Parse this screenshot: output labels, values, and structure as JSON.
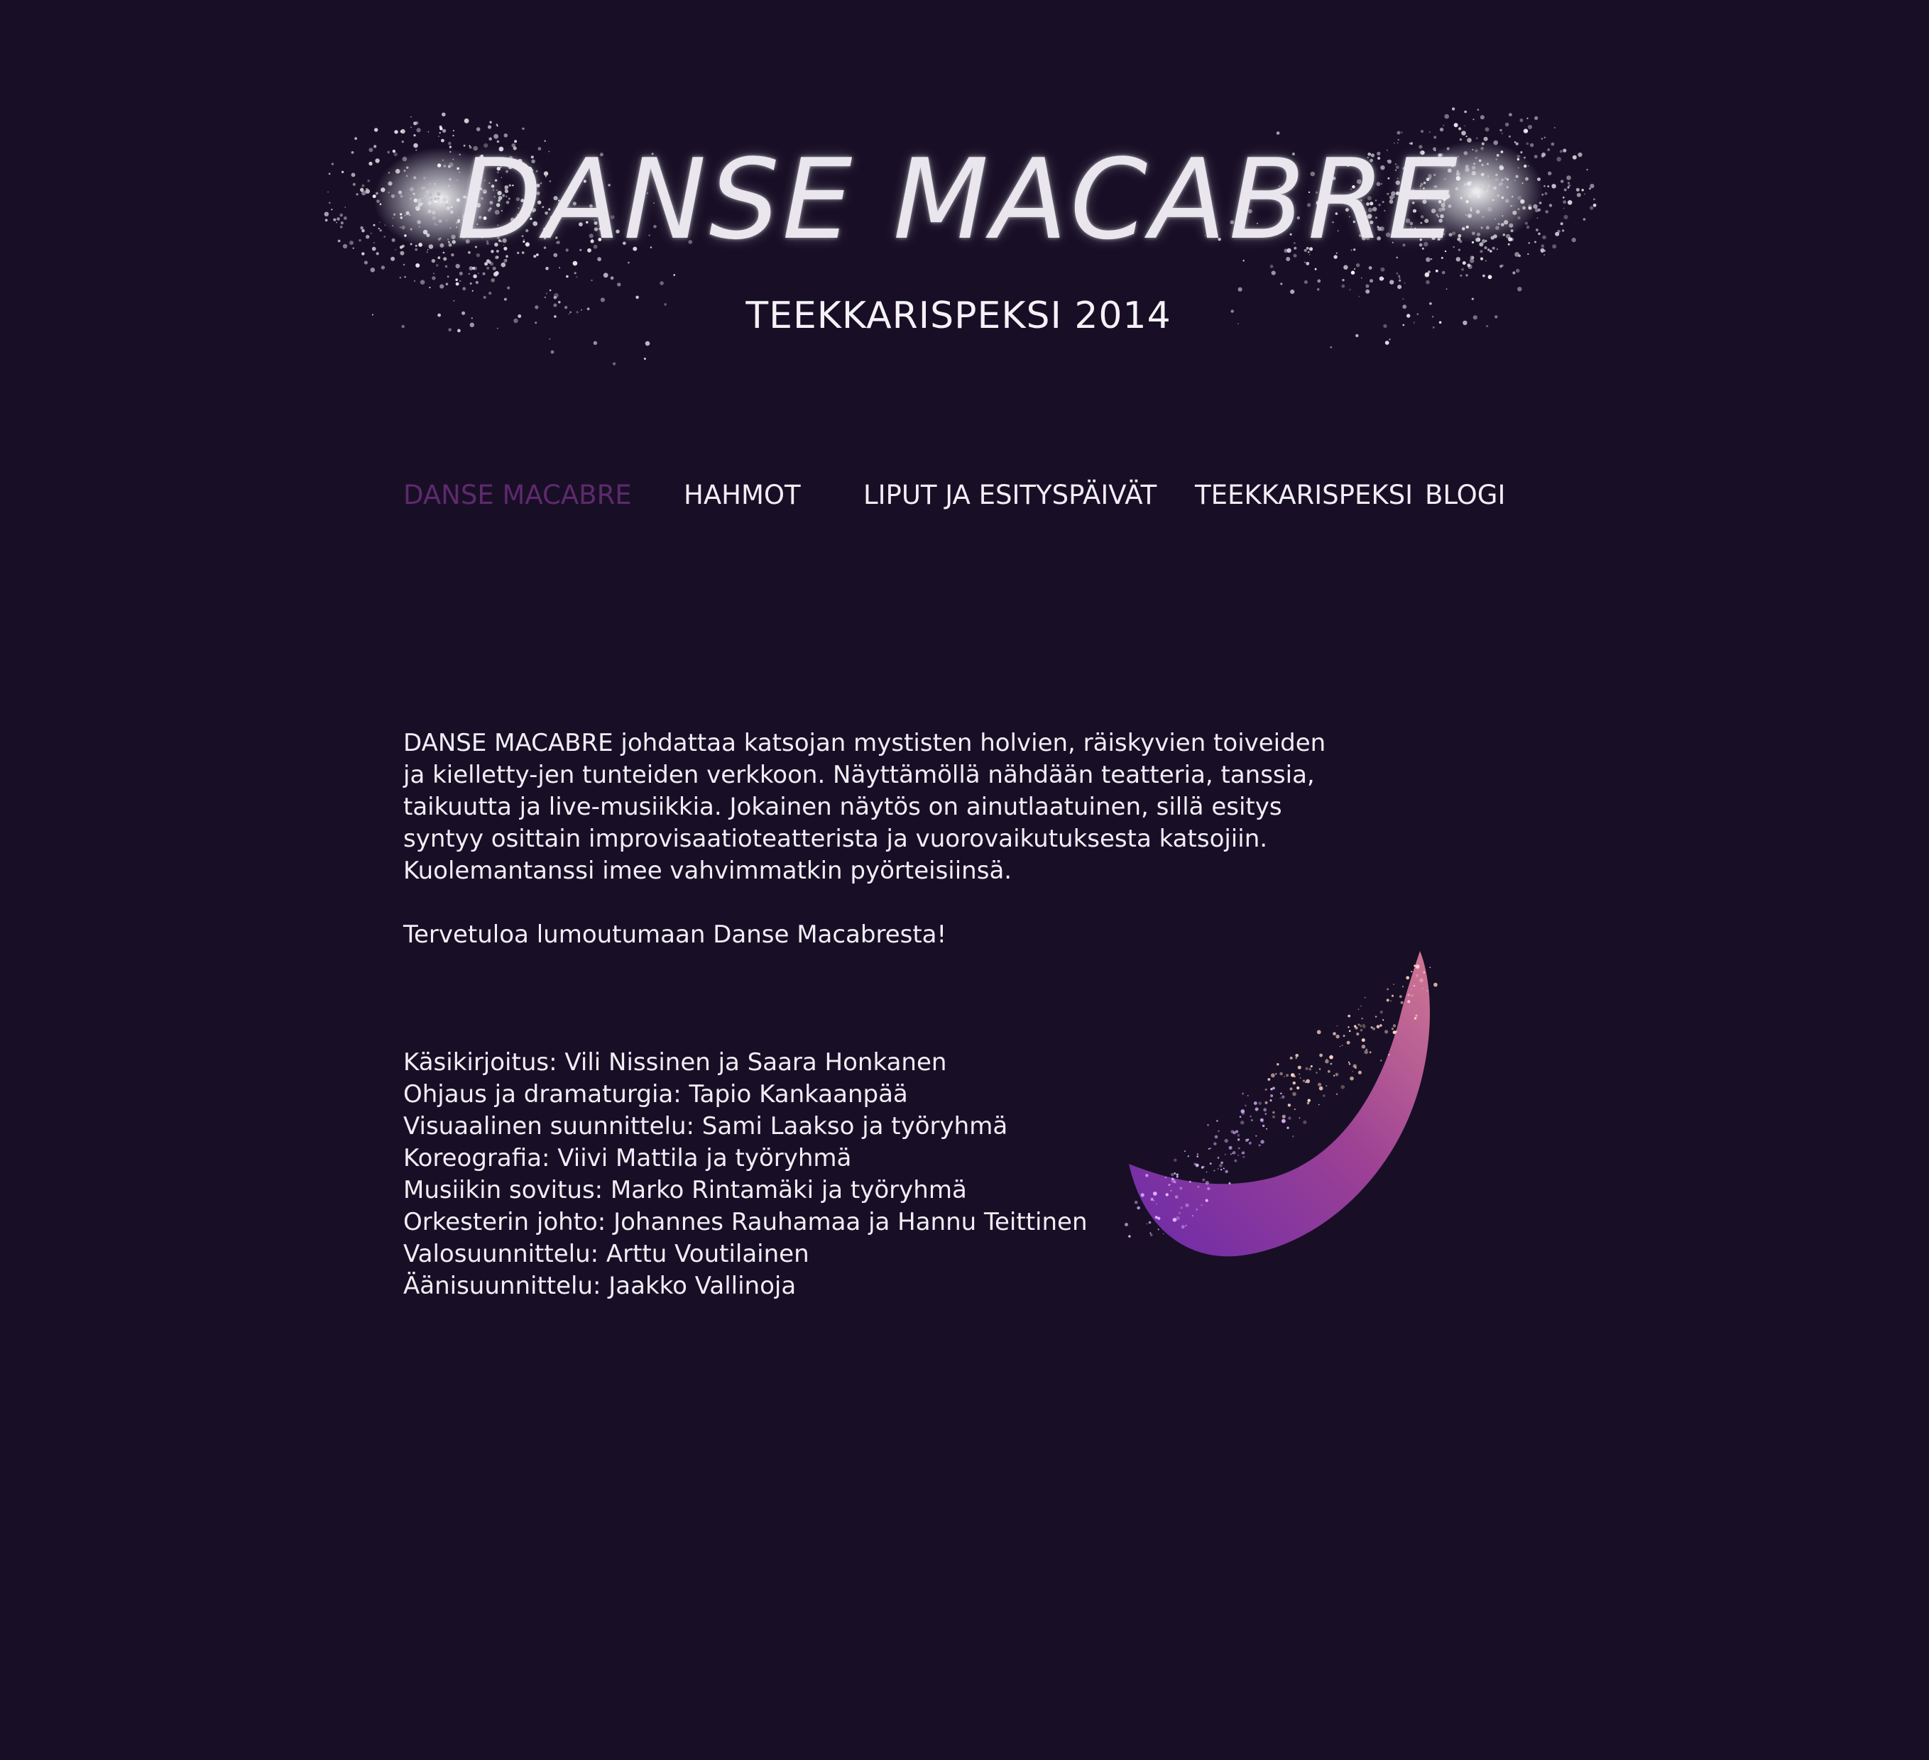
{
  "header": {
    "title": "DANSE MACABRE",
    "subtitle": "TEEKKARISPEKSI 2014"
  },
  "nav": {
    "items": [
      {
        "label": "DANSE MACABRE",
        "active": true
      },
      {
        "label": "HAHMOT",
        "active": false
      },
      {
        "label": "LIPUT JA ESITYSPÄIVÄT",
        "active": false
      },
      {
        "label": "TEEKKARISPEKSI",
        "active": false
      },
      {
        "label": "BLOGI",
        "active": false
      }
    ]
  },
  "main": {
    "intro": "DANSE MACABRE johdattaa katsojan mystisten holvien, räiskyvien toiveiden ja kielletty-jen tunteiden verkkoon. Näyttämöllä nähdään teatteria, tanssia, taikuutta ja live-musiikkia. Jokainen näytös on ainutlaatuinen, sillä esitys syntyy osittain improvisaatioteatterista ja vuorovaikutuksesta katsojiin. Kuolemantanssi imee vahvimmatkin pyörteisiinsä.",
    "welcome": "Tervetuloa lumoutumaan Danse Macabresta!",
    "credits": [
      "Käsikirjoitus: Vili Nissinen ja Saara Honkanen",
      "Ohjaus ja dramaturgia: Tapio Kankaanpää",
      "Visuaalinen suunnittelu: Sami Laakso ja työryhmä",
      "Koreografia: Viivi Mattila ja työryhmä",
      "Musiikin sovitus: Marko Rintamäki ja työryhmä",
      "Orkesterin johto: Johannes Rauhamaa ja Hannu Teittinen",
      "Valosuunnittelu: Arttu Voutilainen",
      "Äänisuunnittelu: Jaakko Vallinoja"
    ]
  },
  "colors": {
    "background": "#180f26",
    "text": "#f1eef5",
    "nav_active": "#5e2a6c",
    "feather_pink": "#f08aa8",
    "feather_purple": "#7a2fc0"
  }
}
